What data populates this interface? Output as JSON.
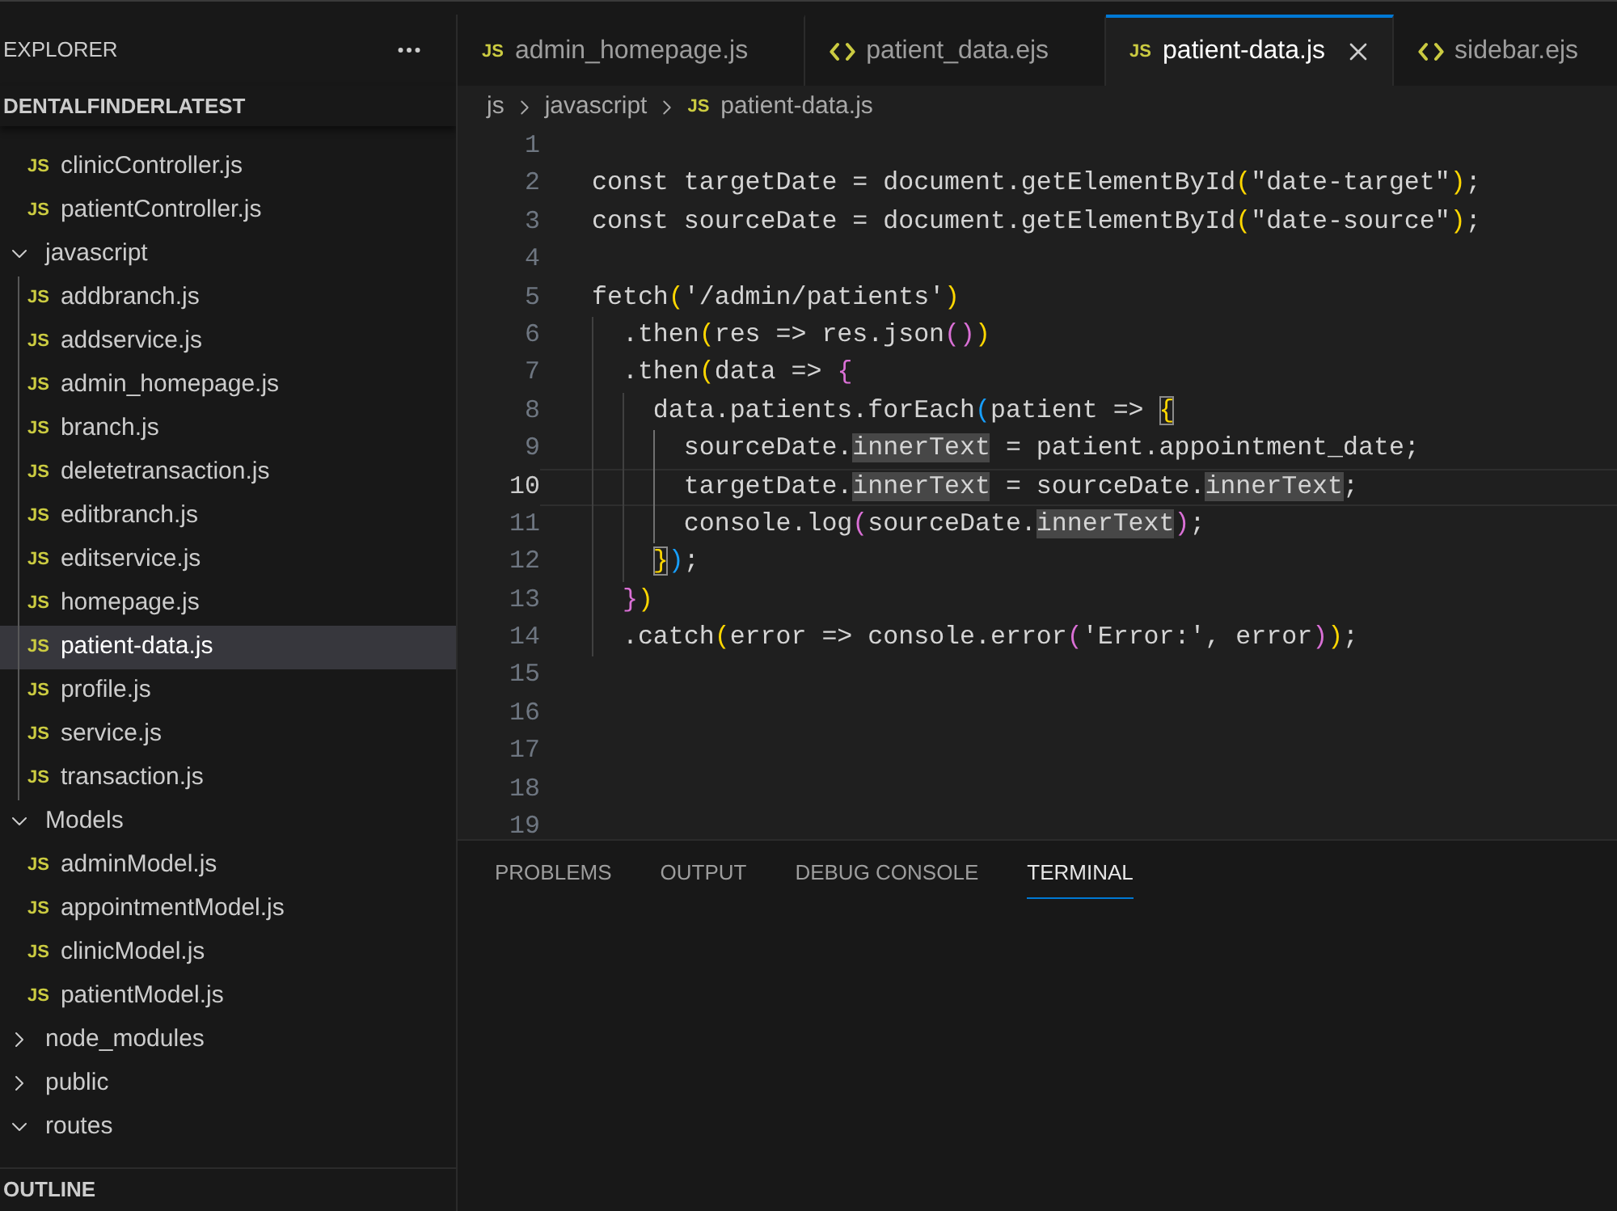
{
  "sidebar": {
    "title": "EXPLORER",
    "workspace": "DENTALFINDERLATEST",
    "tree": [
      {
        "kind": "continuation",
        "children": [
          {
            "kind": "js_file",
            "icon_text": "JS",
            "name": "clinicController.js",
            "selected": false
          },
          {
            "kind": "js_file",
            "icon_text": "JS",
            "name": "patientController.js",
            "selected": false
          }
        ]
      },
      {
        "kind": "folder",
        "name": "javascript",
        "expanded": true,
        "selected": false,
        "children": [
          {
            "kind": "js_file",
            "icon_text": "JS",
            "name": "addbranch.js",
            "selected": false
          },
          {
            "kind": "js_file",
            "icon_text": "JS",
            "name": "addservice.js",
            "selected": false
          },
          {
            "kind": "js_file",
            "icon_text": "JS",
            "name": "admin_homepage.js",
            "selected": false
          },
          {
            "kind": "js_file",
            "icon_text": "JS",
            "name": "branch.js",
            "selected": false
          },
          {
            "kind": "js_file",
            "icon_text": "JS",
            "name": "deletetransaction.js",
            "selected": false
          },
          {
            "kind": "js_file",
            "icon_text": "JS",
            "name": "editbranch.js",
            "selected": false
          },
          {
            "kind": "js_file",
            "icon_text": "JS",
            "name": "editservice.js",
            "selected": false
          },
          {
            "kind": "js_file",
            "icon_text": "JS",
            "name": "homepage.js",
            "selected": false
          },
          {
            "kind": "js_file",
            "icon_text": "JS",
            "name": "patient-data.js",
            "selected": true
          },
          {
            "kind": "js_file",
            "icon_text": "JS",
            "name": "profile.js",
            "selected": false
          },
          {
            "kind": "js_file",
            "icon_text": "JS",
            "name": "service.js",
            "selected": false
          },
          {
            "kind": "js_file",
            "icon_text": "JS",
            "name": "transaction.js",
            "selected": false
          }
        ]
      },
      {
        "kind": "folder",
        "name": "Models",
        "expanded": true,
        "selected": false,
        "children": [
          {
            "kind": "js_file",
            "icon_text": "JS",
            "name": "adminModel.js",
            "selected": false
          },
          {
            "kind": "js_file",
            "icon_text": "JS",
            "name": "appointmentModel.js",
            "selected": false
          },
          {
            "kind": "js_file",
            "icon_text": "JS",
            "name": "clinicModel.js",
            "selected": false
          },
          {
            "kind": "js_file",
            "icon_text": "JS",
            "name": "patientModel.js",
            "selected": false
          }
        ]
      },
      {
        "kind": "folder",
        "name": "node_modules",
        "expanded": false,
        "selected": false
      },
      {
        "kind": "folder",
        "name": "public",
        "expanded": false,
        "selected": false
      },
      {
        "kind": "folder",
        "name": "routes",
        "expanded": true,
        "selected": false
      }
    ],
    "outline": "OUTLINE"
  },
  "tabs": [
    {
      "kind": "js",
      "icon_text": "JS",
      "label": "admin_homepage.js",
      "selected": false
    },
    {
      "kind": "ejs",
      "label": "patient_data.ejs",
      "selected": false
    },
    {
      "kind": "js",
      "icon_text": "JS",
      "label": "patient-data.js",
      "selected": true
    },
    {
      "kind": "ejs",
      "label": "sidebar.ejs",
      "selected": false
    }
  ],
  "breadcrumb": [
    {
      "kind": "folder",
      "label": "js"
    },
    {
      "kind": "folder",
      "label": "javascript"
    },
    {
      "kind": "js_file",
      "icon_text": "JS",
      "label": "patient-data.js"
    }
  ],
  "editor": {
    "lines": [
      {
        "number": "1",
        "current": false
      },
      {
        "number": "2",
        "current": false,
        "tokens": [
          {
            "kind": "text",
            "text": "const targetDate = document.getElementById"
          },
          {
            "kind": "bracket",
            "text": "(",
            "color": "#ffd700",
            "matched": false
          },
          {
            "kind": "text",
            "text": "\"date-target\""
          },
          {
            "kind": "bracket",
            "text": ")",
            "color": "#ffd700",
            "matched": false
          },
          {
            "kind": "text",
            "text": ";"
          }
        ]
      },
      {
        "number": "3",
        "current": false,
        "tokens": [
          {
            "kind": "text",
            "text": "const sourceDate = document.getElementById"
          },
          {
            "kind": "bracket",
            "text": "(",
            "color": "#ffd700",
            "matched": false
          },
          {
            "kind": "text",
            "text": "\"date-source\""
          },
          {
            "kind": "bracket",
            "text": ")",
            "color": "#ffd700",
            "matched": false
          },
          {
            "kind": "text",
            "text": ";"
          }
        ]
      },
      {
        "number": "4",
        "current": false
      },
      {
        "number": "5",
        "current": false,
        "tokens": [
          {
            "kind": "text",
            "text": "fetch"
          },
          {
            "kind": "bracket",
            "text": "(",
            "color": "#ffd700",
            "matched": false
          },
          {
            "kind": "text",
            "text": "'/admin/patients'"
          },
          {
            "kind": "bracket",
            "text": ")",
            "color": "#ffd700",
            "matched": false
          }
        ]
      },
      {
        "number": "6",
        "current": false,
        "tokens": [
          {
            "kind": "text",
            "text": "  .then"
          },
          {
            "kind": "bracket",
            "text": "(",
            "color": "#ffd700",
            "matched": false
          },
          {
            "kind": "text",
            "text": "res => res.json"
          },
          {
            "kind": "bracket",
            "text": "(",
            "color": "#da70d6",
            "matched": false
          },
          {
            "kind": "bracket",
            "text": ")",
            "color": "#da70d6",
            "matched": false
          },
          {
            "kind": "bracket",
            "text": ")",
            "color": "#ffd700",
            "matched": false
          }
        ]
      },
      {
        "number": "7",
        "current": false,
        "tokens": [
          {
            "kind": "text",
            "text": "  .then"
          },
          {
            "kind": "bracket",
            "text": "(",
            "color": "#ffd700",
            "matched": false
          },
          {
            "kind": "text",
            "text": "data => "
          },
          {
            "kind": "bracket",
            "text": "{",
            "color": "#da70d6",
            "matched": false
          }
        ]
      },
      {
        "number": "8",
        "current": false,
        "tokens": [
          {
            "kind": "text",
            "text": "    data.patients.forEach"
          },
          {
            "kind": "bracket",
            "text": "(",
            "color": "#179fff",
            "matched": false
          },
          {
            "kind": "text",
            "text": "patient => "
          },
          {
            "kind": "bracket",
            "text": "{",
            "color": "#ffd700",
            "matched": true
          }
        ]
      },
      {
        "number": "9",
        "current": false,
        "tokens": [
          {
            "kind": "text",
            "text": "      sourceDate."
          },
          {
            "kind": "occurrence",
            "text": "innerText"
          },
          {
            "kind": "text",
            "text": " = patient.appointment_date;"
          }
        ]
      },
      {
        "number": "10",
        "current": true,
        "tokens": [
          {
            "kind": "text",
            "text": "      targetDate."
          },
          {
            "kind": "occurrence",
            "text": "innerText"
          },
          {
            "kind": "text",
            "text": " = sourceDate."
          },
          {
            "kind": "occurrence",
            "text": "innerText"
          },
          {
            "kind": "text",
            "text": ";"
          }
        ]
      },
      {
        "number": "11",
        "current": false,
        "tokens": [
          {
            "kind": "text",
            "text": "      console.log"
          },
          {
            "kind": "bracket",
            "text": "(",
            "color": "#da70d6",
            "matched": false
          },
          {
            "kind": "text",
            "text": "sourceDate."
          },
          {
            "kind": "occurrence",
            "text": "innerText"
          },
          {
            "kind": "bracket",
            "text": ")",
            "color": "#da70d6",
            "matched": false
          },
          {
            "kind": "text",
            "text": ";"
          }
        ]
      },
      {
        "number": "12",
        "current": false,
        "tokens": [
          {
            "kind": "bracket",
            "text": "    }",
            "color": "#ffd700",
            "matched": true
          },
          {
            "kind": "bracket",
            "text": ")",
            "color": "#179fff",
            "matched": false
          },
          {
            "kind": "text",
            "text": ";"
          }
        ]
      },
      {
        "number": "13",
        "current": false,
        "tokens": [
          {
            "kind": "bracket",
            "text": "  }",
            "color": "#da70d6",
            "matched": false
          },
          {
            "kind": "bracket",
            "text": ")",
            "color": "#ffd700",
            "matched": false
          }
        ]
      },
      {
        "number": "14",
        "current": false,
        "tokens": [
          {
            "kind": "text",
            "text": "  .catch"
          },
          {
            "kind": "bracket",
            "text": "(",
            "color": "#ffd700",
            "matched": false
          },
          {
            "kind": "text",
            "text": "error => console.error"
          },
          {
            "kind": "bracket",
            "text": "(",
            "color": "#da70d6",
            "matched": false
          },
          {
            "kind": "text",
            "text": "'Error:', error"
          },
          {
            "kind": "bracket",
            "text": ")",
            "color": "#da70d6",
            "matched": false
          },
          {
            "kind": "bracket",
            "text": ")",
            "color": "#ffd700",
            "matched": false
          },
          {
            "kind": "text",
            "text": ";"
          }
        ]
      },
      {
        "number": "15",
        "current": false
      },
      {
        "number": "16",
        "current": false
      },
      {
        "number": "17",
        "current": false
      },
      {
        "number": "18",
        "current": false
      },
      {
        "number": "19",
        "current": false
      }
    ]
  },
  "panel": {
    "tabs": [
      {
        "label": "PROBLEMS",
        "selected": false
      },
      {
        "label": "OUTPUT",
        "selected": false
      },
      {
        "label": "DEBUG CONSOLE",
        "selected": false
      },
      {
        "label": "TERMINAL",
        "selected": true
      }
    ]
  }
}
